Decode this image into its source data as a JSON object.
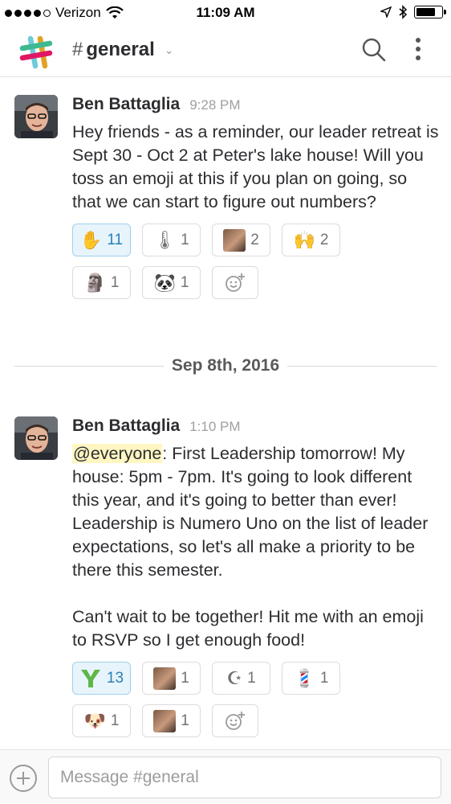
{
  "status_bar": {
    "carrier": "Verizon",
    "time": "11:09 AM",
    "signal_bars": 4,
    "signal_total": 5,
    "battery_level": 0.75
  },
  "header": {
    "hash": "#",
    "channel": "general",
    "caret": "⌄"
  },
  "colors": {
    "accent": "#2a80b9",
    "mention_bg": "#fff6c2",
    "reaction_mine_bg": "#e8f4fb"
  },
  "messages": [
    {
      "author": "Ben Battaglia",
      "time": "9:28 PM",
      "text": "Hey friends - as a reminder, our leader retreat is Sept 30 - Oct 2 at Peter's lake house! Will you toss an emoji at this if you plan on going, so that we can start to figure out numbers?",
      "reactions": [
        {
          "icon": "raised-hand-icon",
          "glyph": "✋",
          "count": "11",
          "mine": true
        },
        {
          "icon": "thermometer-icon",
          "glyph": "🌡",
          "count": "1",
          "mine": false
        },
        {
          "icon": "custom-photo-emoji-icon",
          "glyph": "",
          "count": "2",
          "mine": false
        },
        {
          "icon": "raised-hands-icon",
          "glyph": "🙌",
          "count": "2",
          "mine": false
        },
        {
          "icon": "moai-icon",
          "glyph": "🗿",
          "count": "1",
          "mine": false
        },
        {
          "icon": "panda-icon",
          "glyph": "🐼",
          "count": "1",
          "mine": false
        }
      ]
    },
    {
      "author": "Ben Battaglia",
      "time": "1:10 PM",
      "mention": "@everyone",
      "text": ": First Leadership tomorrow! My house: 5pm - 7pm. It's going to look different this year, and it's going to better than ever! Leadership is Numero Uno on the list of leader expectations, so let's all make a priority to be there this semester.\n\nCan't wait to be together! Hit me with an emoji to RSVP so I get enough food!",
      "reactions": [
        {
          "icon": "younglife-logo-icon",
          "glyph": "",
          "count": "13",
          "mine": true
        },
        {
          "icon": "custom-photo-emoji-icon",
          "glyph": "",
          "count": "1",
          "mine": false
        },
        {
          "icon": "star-and-crescent-icon",
          "glyph": "☪",
          "count": "1",
          "mine": false
        },
        {
          "icon": "barber-pole-icon",
          "glyph": "💈",
          "count": "1",
          "mine": false
        },
        {
          "icon": "dog-face-icon",
          "glyph": "🐶",
          "count": "1",
          "mine": false
        },
        {
          "icon": "custom-photo-emoji-icon",
          "glyph": "",
          "count": "1",
          "mine": false
        }
      ]
    }
  ],
  "date_divider": "Sep 8th, 2016",
  "composer": {
    "placeholder": "Message #general",
    "value": ""
  }
}
